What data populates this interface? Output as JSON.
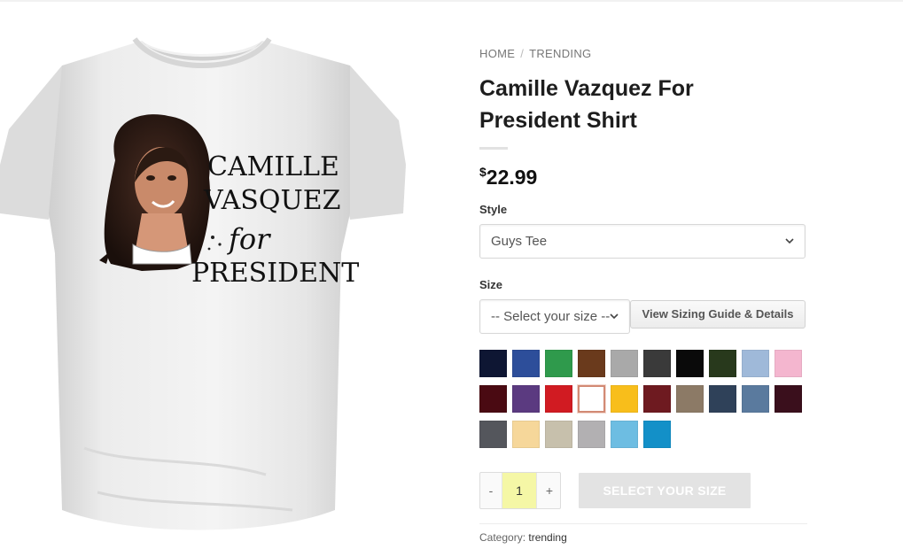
{
  "breadcrumb": {
    "home": "HOME",
    "separator": "/",
    "current": "TRENDING"
  },
  "product": {
    "title": "Camille Vazquez For President Shirt",
    "currency_symbol": "$",
    "price": "22.99",
    "shirt_print": {
      "line1": "CAMILLE",
      "line2": "VASQUEZ",
      "line3": "for",
      "line4": "PRESIDENT"
    }
  },
  "style": {
    "label": "Style",
    "selected": "Guys Tee"
  },
  "size": {
    "label": "Size",
    "selected": "-- Select your size --",
    "guide_button": "View Sizing Guide & Details"
  },
  "colors": {
    "selected_index": 13,
    "swatches": [
      "#0e1633",
      "#2d4e9a",
      "#2f9a4c",
      "#6a3a1c",
      "#a9a9a9",
      "#3a3a3a",
      "#0a0a0a",
      "#28391c",
      "#9fb9d9",
      "#f4b6cf",
      "#4a0a12",
      "#5b3a80",
      "#d11b22",
      "#ffffff",
      "#f8be1b",
      "#6e1a20",
      "#8c7a66",
      "#2f4159",
      "#5a7a9e",
      "#3a0f1c",
      "#54565c",
      "#f6d79a",
      "#c7c0ac",
      "#b2b0b2",
      "#6dbde2",
      "#1390c8"
    ]
  },
  "cart": {
    "minus": "-",
    "quantity": "1",
    "plus": "+",
    "add_button": "SELECT YOUR SIZE"
  },
  "meta": {
    "category_label": "Category:",
    "category_value": "trending"
  }
}
